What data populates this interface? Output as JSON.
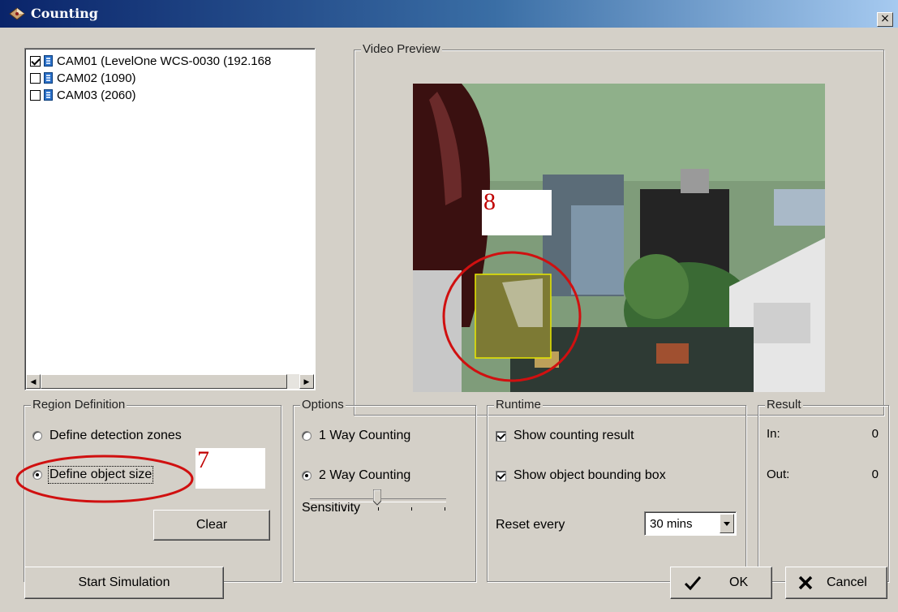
{
  "window": {
    "title": "Counting",
    "close_label": "×"
  },
  "camera_list": {
    "items": [
      {
        "label": "CAM01 (LevelOne WCS-0030 (192.168",
        "checked": true
      },
      {
        "label": "CAM02 (1090)",
        "checked": false
      },
      {
        "label": "CAM03 (2060)",
        "checked": false
      }
    ]
  },
  "video_preview": {
    "label": "Video Preview",
    "annotation": "8"
  },
  "region_definition": {
    "label": "Region Definition",
    "detection_zones_label": "Define detection zones",
    "object_size_label": "Define object size",
    "selected": "Define object size",
    "annotation": "7",
    "clear_label": "Clear"
  },
  "options": {
    "label": "Options",
    "one_way_label": "1 Way Counting",
    "two_way_label": "2 Way Counting",
    "selected": "2 Way Counting",
    "sensitivity_label": "Sensitivity",
    "sensitivity_level": 0.5
  },
  "runtime": {
    "label": "Runtime",
    "show_result_label": "Show counting result",
    "show_result_checked": true,
    "show_bbox_label": "Show object bounding box",
    "show_bbox_checked": true,
    "reset_label": "Reset every",
    "reset_value": "30 mins"
  },
  "result": {
    "label": "Result",
    "in_label": "In:",
    "in_value": "0",
    "out_label": "Out:",
    "out_value": "0"
  },
  "buttons": {
    "start_simulation": "Start Simulation",
    "ok": "OK",
    "cancel": "Cancel"
  },
  "colors": {
    "title_bar": "#0a246a",
    "dialog_bg": "#d4d0c8",
    "annotation_red": "#d01010",
    "bbox_yellow": "#e8e800"
  }
}
